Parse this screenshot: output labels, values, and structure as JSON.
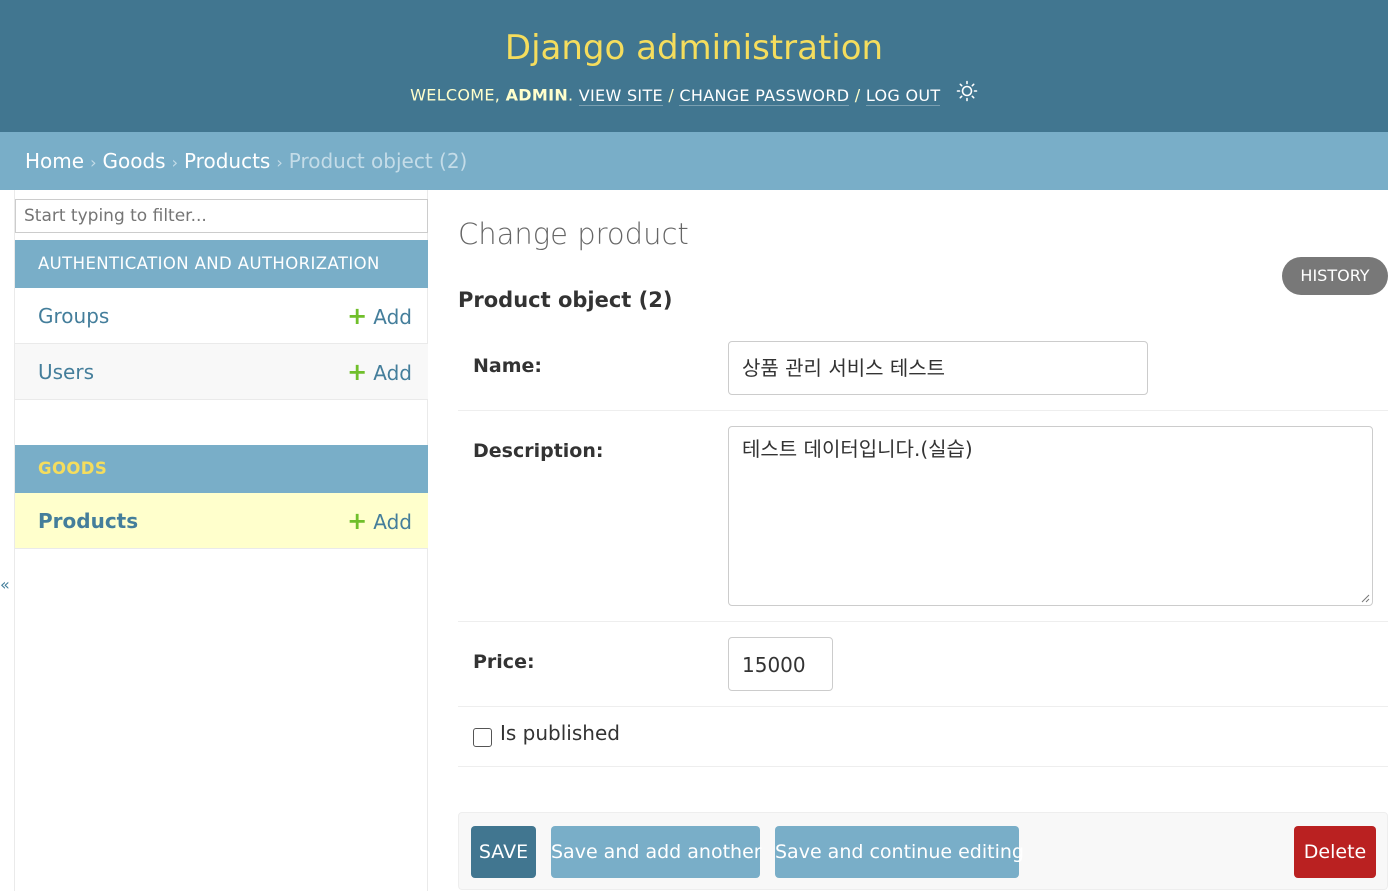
{
  "header": {
    "title": "Django administration",
    "welcome": "Welcome,",
    "username": "admin",
    "view_site": "View site",
    "change_password": "Change password",
    "log_out": "Log out",
    "theme_icon": "sun-icon"
  },
  "breadcrumbs": {
    "home": "Home",
    "app": "Goods",
    "model": "Products",
    "current": "Product object (2)",
    "separator": "›"
  },
  "sidebar": {
    "filter_placeholder": "Start typing to filter...",
    "apps": [
      {
        "name": "Authentication and Authorization",
        "models": [
          {
            "name": "Groups",
            "add": "Add"
          },
          {
            "name": "Users",
            "add": "Add"
          }
        ]
      },
      {
        "name": "Goods",
        "models": [
          {
            "name": "Products",
            "add": "Add"
          }
        ]
      }
    ],
    "toggle_glyph": "«"
  },
  "content": {
    "title": "Change product",
    "history": "History",
    "object_title": "Product object (2)",
    "fields": {
      "name": {
        "label": "Name:",
        "value": "상품 관리 서비스 테스트"
      },
      "description": {
        "label": "Description:",
        "value": "테스트 데이터입니다.(실습)"
      },
      "price": {
        "label": "Price:",
        "value": "15000"
      },
      "is_published": {
        "label": "Is published",
        "checked": false
      }
    },
    "submit": {
      "save": "SAVE",
      "save_add": "Save and add another",
      "save_continue": "Save and continue editing",
      "delete": "Delete"
    }
  },
  "colors": {
    "header_bg": "#417690",
    "branding": "#f5dd5d",
    "breadcrumbs_bg": "#79aec8",
    "link": "#447e9b",
    "add_icon": "#70bf2b",
    "selected_row": "#ffffcc",
    "delete": "#ba2121"
  }
}
